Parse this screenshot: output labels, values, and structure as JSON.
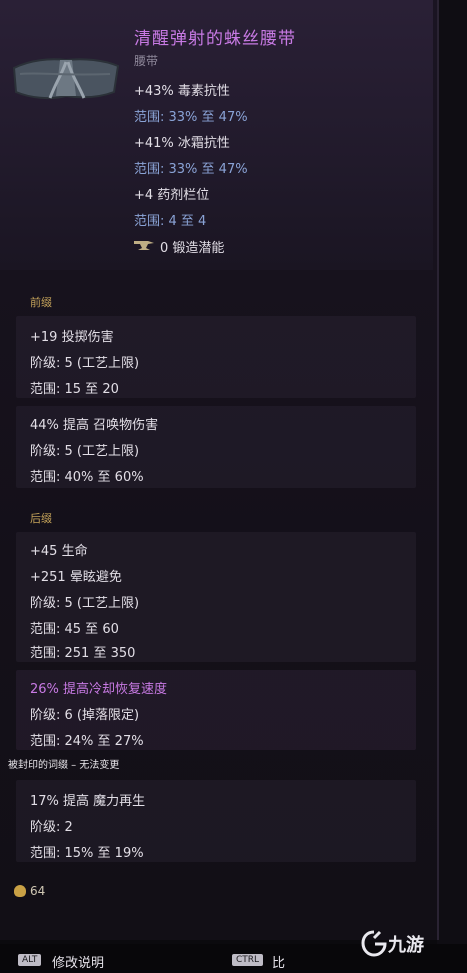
{
  "item": {
    "name": "清醒弹射的蛛丝腰带",
    "type": "腰带",
    "stats": [
      {
        "text": "+43% 毒素抗性",
        "range": "范围: 33% 至 47%"
      },
      {
        "text": "+41% 冰霜抗性",
        "range": "范围: 33% 至 47%"
      },
      {
        "text": "+4 药剂栏位",
        "range": "范围: 4 至 4"
      }
    ],
    "forge": "0 锻造潜能"
  },
  "prefix": {
    "label": "前缀",
    "affixes": [
      {
        "line1": "+19 投掷伤害",
        "tier": "阶级: 5 (工艺上限)",
        "range": "范围: 15 至 20"
      },
      {
        "line1": "44% 提高 召唤物伤害",
        "tier": "阶级: 5 (工艺上限)",
        "range": "范围: 40% 至 60%"
      }
    ]
  },
  "suffix": {
    "label": "后缀",
    "affix1": {
      "line1": "+45 生命",
      "line2": "+251 晕眩避免",
      "tier": "阶级: 5 (工艺上限)",
      "range1": "范围: 45 至 60",
      "range2": "范围: 251 至 350"
    },
    "affix2": {
      "line1": "26% 提高冷却恢复速度",
      "tier": "阶级: 6 (掉落限定)",
      "range": "范围: 24% 至 27%"
    },
    "sealed_note": "被封印的词缀 – 无法变更",
    "affix3": {
      "line1": "17% 提高 魔力再生",
      "tier": "阶级: 2",
      "range": "范围: 15% 至 19%"
    }
  },
  "gold": "64",
  "footer": {
    "alt_key": "ALT",
    "alt_label": "修改说明",
    "ctrl_key": "CTRL",
    "ctrl_label": "比"
  },
  "watermark": "九游"
}
